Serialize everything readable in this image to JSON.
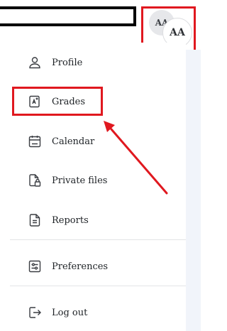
{
  "header": {
    "avatar_back_initials": "AA",
    "avatar_initials": "AA"
  },
  "menu": {
    "items": [
      {
        "label": "Profile",
        "icon": "user-icon"
      },
      {
        "label": "Grades",
        "icon": "grades-icon"
      },
      {
        "label": "Calendar",
        "icon": "calendar-icon"
      },
      {
        "label": "Private files",
        "icon": "private-files-icon"
      },
      {
        "label": "Reports",
        "icon": "reports-icon"
      },
      {
        "label": "Preferences",
        "icon": "preferences-icon"
      },
      {
        "label": "Log out",
        "icon": "log-out-icon"
      }
    ]
  },
  "colors": {
    "highlight": "#e0181f",
    "text": "#1d2125",
    "side_strip": "#f1f4fa"
  }
}
